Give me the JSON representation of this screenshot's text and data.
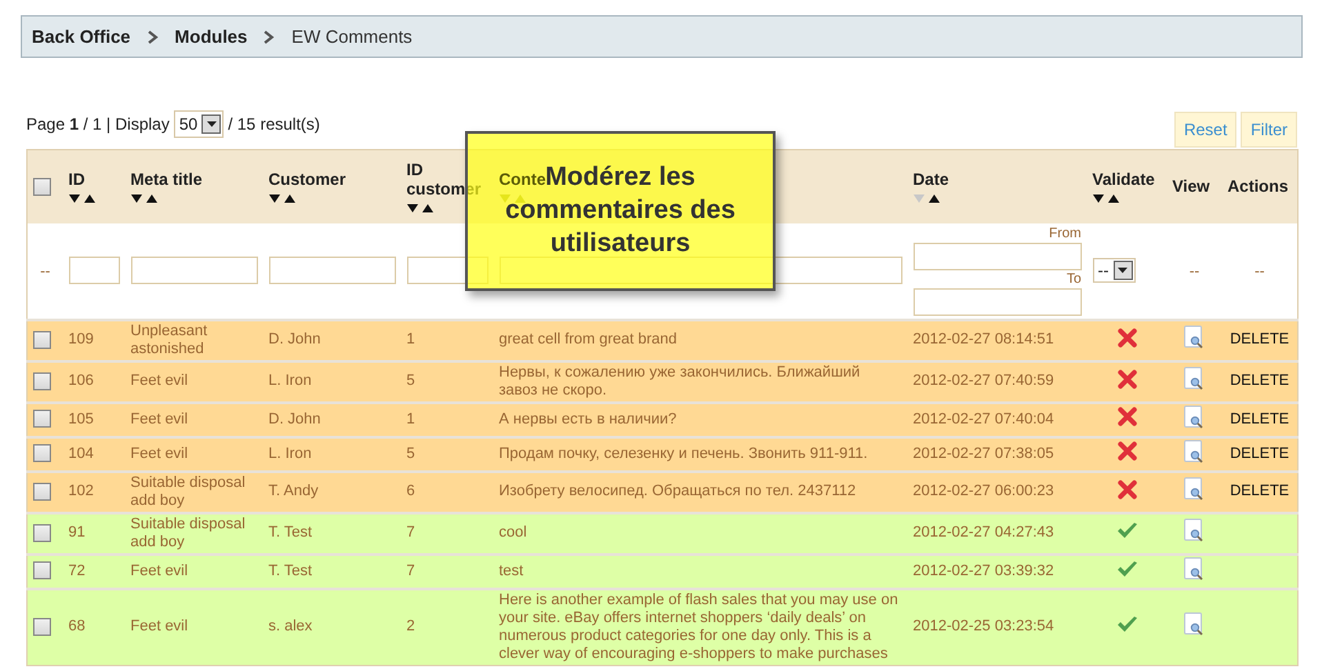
{
  "breadcrumb": [
    "Back Office",
    "Modules",
    "EW Comments"
  ],
  "pagination": {
    "text": "Page **1** / 1 | Display",
    "display_value": "50",
    "results": "/ 15 result(s)"
  },
  "buttons": [
    "Reset",
    "Filter"
  ],
  "select_all_checked": false,
  "columns": [
    {
      "label": "ID",
      "sortable": true,
      "sorted": false,
      "kind": "text"
    },
    {
      "label": "Meta title",
      "sortable": true,
      "sorted": false,
      "kind": "text"
    },
    {
      "label": "Customer",
      "sortable": true,
      "sorted": false,
      "kind": "text"
    },
    {
      "label": "ID customer",
      "sortable": true,
      "sorted": false,
      "kind": "text"
    },
    {
      "label": "Conte",
      "sortable": true,
      "sorted": false,
      "kind": "text"
    },
    {
      "label": "Date",
      "sortable": true,
      "sorted": true,
      "kind": "daterange"
    },
    {
      "label": "Validate",
      "sortable": true,
      "sorted": false,
      "kind": "select"
    },
    {
      "label": "View",
      "sortable": false,
      "kind": "none"
    },
    {
      "label": "Actions",
      "sortable": false,
      "kind": "none"
    }
  ],
  "filters": {
    "checkbox_col": "--",
    "from": "From",
    "to": "To",
    "validate_value": "--",
    "view": "--",
    "actions": "--"
  },
  "rows": [
    {
      "checked": false,
      "id": "109",
      "meta_title": "Unpleasant astonished",
      "customer": "D. John",
      "id_customer": "1",
      "content": "great cell from great brand",
      "date": "2012-02-27 08:14:51",
      "validated": false,
      "action": "DELETE"
    },
    {
      "checked": false,
      "id": "106",
      "meta_title": "Feet evil",
      "customer": "L. Iron",
      "id_customer": "5",
      "content": "Нервы, к сожалению уже закончились. Ближайший завоз не скоро.",
      "date": "2012-02-27 07:40:59",
      "validated": false,
      "action": "DELETE"
    },
    {
      "checked": false,
      "id": "105",
      "meta_title": "Feet evil",
      "customer": "D. John",
      "id_customer": "1",
      "content": "А нервы есть в наличии?",
      "date": "2012-02-27 07:40:04",
      "validated": false,
      "action": "DELETE"
    },
    {
      "checked": false,
      "id": "104",
      "meta_title": "Feet evil",
      "customer": "L. Iron",
      "id_customer": "5",
      "content": "Продам почку, селезенку и печень. Звонить 911-911.",
      "date": "2012-02-27 07:38:05",
      "validated": false,
      "action": "DELETE"
    },
    {
      "checked": false,
      "id": "102",
      "meta_title": "Suitable disposal add boy",
      "customer": "T. Andy",
      "id_customer": "6",
      "content": "Изобрету велосипед. Обращаться по тел. 2437112",
      "date": "2012-02-27 06:00:23",
      "validated": false,
      "action": "DELETE"
    },
    {
      "checked": false,
      "id": "91",
      "meta_title": "Suitable disposal add boy",
      "customer": "T. Test",
      "id_customer": "7",
      "content": "cool",
      "date": "2012-02-27 04:27:43",
      "validated": true
    },
    {
      "checked": false,
      "id": "72",
      "meta_title": "Feet evil",
      "customer": "T. Test",
      "id_customer": "7",
      "content": "test",
      "date": "2012-02-27 03:39:32",
      "validated": true
    },
    {
      "checked": false,
      "id": "68",
      "meta_title": "Feet evil",
      "customer": "s. alex",
      "id_customer": "2",
      "content": "Here is another example of flash sales that you may use on your site. eBay offers internet shoppers ‘daily deals’ on numerous product categories for one day only. This is a clever way of encouraging e-shoppers to make purchases",
      "date": "2012-02-25 03:23:54",
      "validated": true
    }
  ],
  "callout": "Modérez les commentaires des utilisateurs"
}
